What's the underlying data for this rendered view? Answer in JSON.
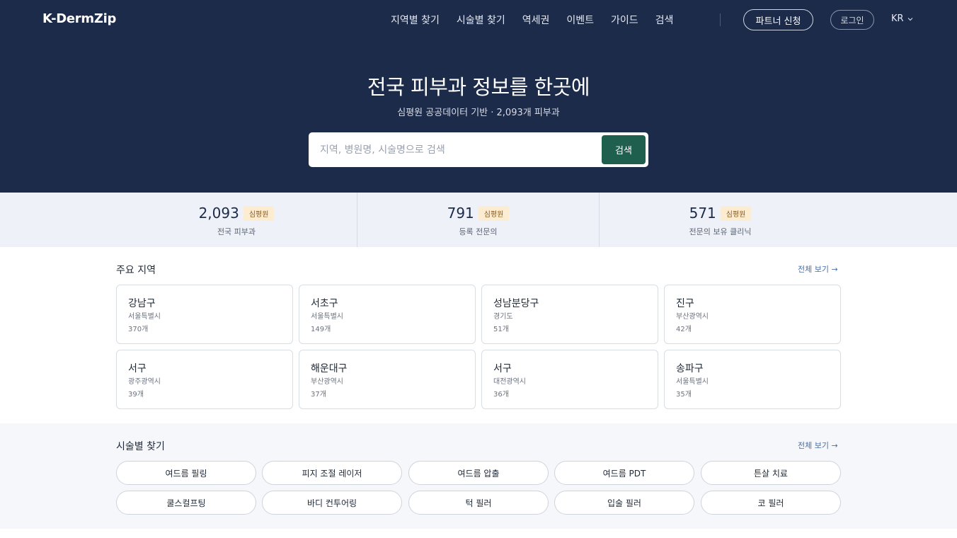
{
  "header": {
    "brand": "K-DermZip",
    "nav": [
      "지역별 찾기",
      "시술별 찾기",
      "역세권",
      "이벤트",
      "가이드",
      "검색"
    ],
    "partner_label": "파트너 신청",
    "login_label": "로그인",
    "lang_label": "KR"
  },
  "hero": {
    "title": "전국 피부과 정보를 한곳에",
    "subtitle": "심평원 공공데이터 기반 · 2,093개 피부과",
    "search_placeholder": "지역, 병원명, 시술명으로 검색",
    "search_value": "",
    "search_button": "검색"
  },
  "stats": [
    {
      "value": "2,093",
      "badge": "심평원",
      "label": "전국 피부과"
    },
    {
      "value": "791",
      "badge": "심평원",
      "label": "등록 전문의"
    },
    {
      "value": "571",
      "badge": "심평원",
      "label": "전문의 보유 클리닉"
    }
  ],
  "regions": {
    "title": "주요 지역",
    "see_all": "전체 보기 →",
    "items": [
      {
        "name": "강남구",
        "city": "서울특별시",
        "count": "370개"
      },
      {
        "name": "서초구",
        "city": "서울특별시",
        "count": "149개"
      },
      {
        "name": "성남분당구",
        "city": "경기도",
        "count": "51개"
      },
      {
        "name": "진구",
        "city": "부산광역시",
        "count": "42개"
      },
      {
        "name": "서구",
        "city": "광주광역시",
        "count": "39개"
      },
      {
        "name": "해운대구",
        "city": "부산광역시",
        "count": "37개"
      },
      {
        "name": "서구",
        "city": "대전광역시",
        "count": "36개"
      },
      {
        "name": "송파구",
        "city": "서울특별시",
        "count": "35개"
      }
    ]
  },
  "treatments": {
    "title": "시술별 찾기",
    "see_all": "전체 보기 →",
    "items": [
      "여드름 필링",
      "피지 조절 레이저",
      "여드름 압출",
      "여드름 PDT",
      "튼살 치료",
      "쿨스컬프팅",
      "바디 컨투어링",
      "턱 필러",
      "입술 필러",
      "코 필러"
    ]
  },
  "colors": {
    "navy": "#1c2b4a",
    "search_button": "#1f5f4e",
    "badge_bg": "#fbecd2",
    "stats_bg": "#eef1f8"
  }
}
